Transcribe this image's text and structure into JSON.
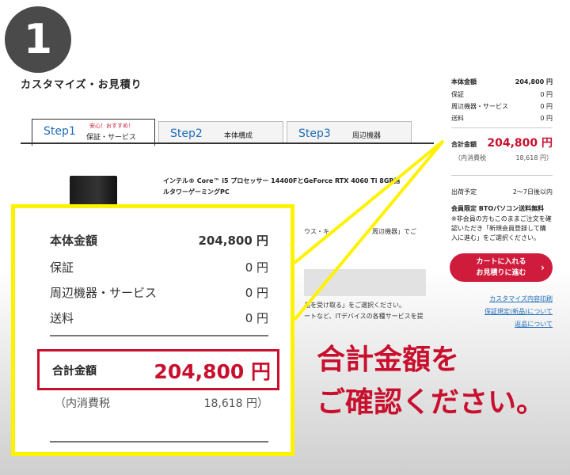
{
  "step_badge": "1",
  "page_title": "カスタマイズ・お見積り",
  "tabs": [
    {
      "step": "Step1",
      "name": "保証・サービス",
      "badge": "安心！おすすめ！"
    },
    {
      "step": "Step2",
      "name": "本体構成"
    },
    {
      "step": "Step3",
      "name": "周辺機器"
    }
  ],
  "product": {
    "name_line1": "インテル® Core™ i5 プロセッサー 14400FとGeForce RTX 4060 Ti 8GB搭",
    "name_line2": "ルタワーゲーミングPC",
    "text_a": "ウス・キ",
    "text_b": "周辺機器」でご",
    "text_c": "品を受け取る」をご選択ください。",
    "text_d": "ートなど、ITデバイスの各種サービスを提"
  },
  "summary": {
    "rows": [
      {
        "label": "本体金額",
        "value": "204,800 円"
      },
      {
        "label": "保証",
        "value": "0 円"
      },
      {
        "label": "周辺機器・サービス",
        "value": "0 円"
      },
      {
        "label": "送料",
        "value": "0 円"
      }
    ],
    "total_label": "合計金額",
    "total_value": "204,800 円",
    "tax_label": "（内消費税",
    "tax_value": "18,618 円）",
    "ship_label": "出荷予定",
    "ship_value": "2〜7日後以内",
    "notice_title": "会員限定 BTOパソコン送料無料",
    "notice_body1": "※非会員の方もこのままご注文を確",
    "notice_body2": "入に進む」をご選択ください。",
    "notice_body1b": "認いただき「新規会員登録して購",
    "cart_line1": "カートに入れる",
    "cart_line2": "お見積りに進む",
    "links": [
      "カスタマイズ内容印刷",
      "保証規定(新品)について",
      "返品について"
    ]
  },
  "zoom": {
    "rows": [
      {
        "label": "本体金額",
        "value": "204,800 円"
      },
      {
        "label": "保証",
        "value": "0 円"
      },
      {
        "label": "周辺機器・サービス",
        "value": "0 円"
      },
      {
        "label": "送料",
        "value": "0 円"
      }
    ],
    "total_label": "合計金額",
    "total_value": "204,800 円",
    "tax_label": "（内消費税",
    "tax_value": "18,618 円）"
  },
  "message_line1": "合計金額を",
  "message_line2": "ご確認ください。",
  "colors": {
    "accent_red": "#c8102e",
    "highlight_yellow": "#fff200",
    "link_blue": "#1e6bb8",
    "button_red": "#d01c3c"
  }
}
